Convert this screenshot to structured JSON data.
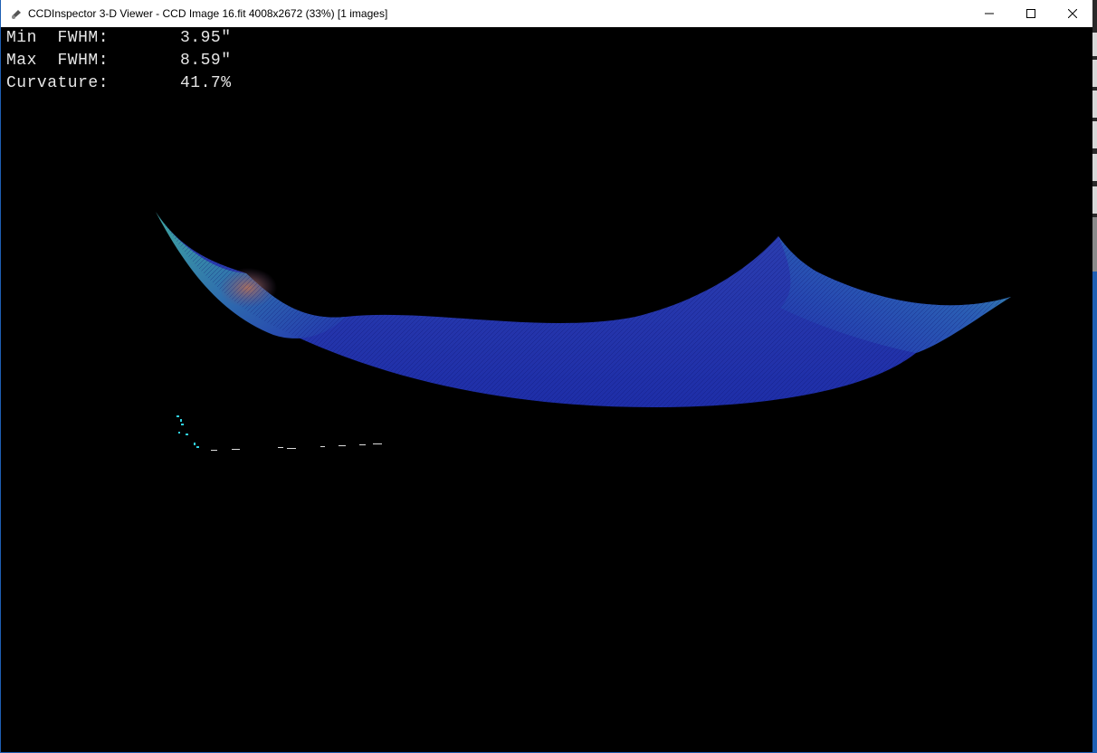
{
  "window": {
    "title": "CCDInspector 3-D Viewer - CCD Image 16.fit 4008x2672 (33%)  [1 images]",
    "controls": {
      "minimize": "minimize",
      "maximize": "maximize",
      "close": "close"
    }
  },
  "stats": [
    {
      "label": "Min  FWHM:",
      "value": "3.95\""
    },
    {
      "label": "Max  FWHM:",
      "value": "8.59\""
    },
    {
      "label": "Curvature:",
      "value": "41.7%"
    }
  ],
  "colors": {
    "surface_low": "#1f2fb0",
    "surface_mid": "#2a4fb8",
    "surface_edge": "#3fa7a0",
    "surface_peak": "#a86a5a",
    "axis_dots": "#30d0e0"
  },
  "icons": {
    "app": "telescope-icon",
    "minimize": "minimize-icon",
    "maximize": "maximize-icon",
    "close": "close-icon"
  }
}
